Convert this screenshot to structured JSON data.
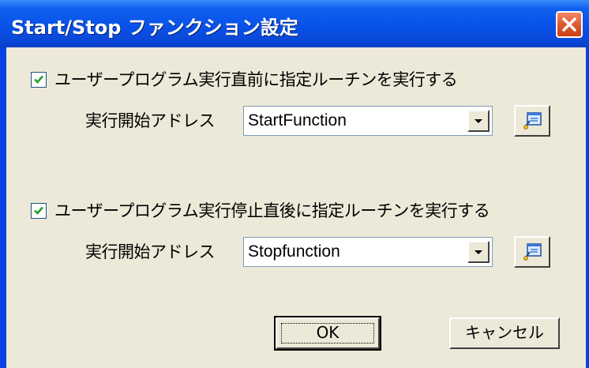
{
  "window": {
    "title": "Start/Stop ファンクション設定",
    "close_icon": "close-x-icon"
  },
  "start": {
    "checkbox_checked": true,
    "checkbox_label": "ユーザープログラム実行直前に指定ルーチンを実行する",
    "address_label": "実行開始アドレス",
    "address_value": "StartFunction",
    "browse_icon": "browse-symbol-icon"
  },
  "stop": {
    "checkbox_checked": true,
    "checkbox_label": "ユーザープログラム実行停止直後に指定ルーチンを実行する",
    "address_label": "実行開始アドレス",
    "address_value": "Stopfunction",
    "browse_icon": "browse-symbol-icon"
  },
  "buttons": {
    "ok": "OK",
    "cancel": "キャンセル"
  },
  "colors": {
    "title_bar": "#0a48d8",
    "client_bg": "#ece9d8",
    "close_button": "#e05a30"
  }
}
